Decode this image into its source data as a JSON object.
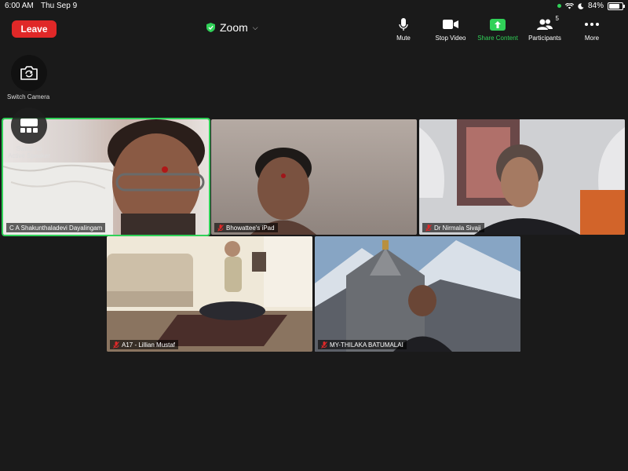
{
  "status_bar": {
    "time": "6:00 AM",
    "date": "Thu Sep 9",
    "battery": "84%",
    "battery_level": 0.84
  },
  "topbar": {
    "leave_label": "Leave",
    "app_title": "Zoom",
    "toolbar": [
      {
        "id": "mute",
        "label": "Mute",
        "icon": "microphone-icon"
      },
      {
        "id": "stop-video",
        "label": "Stop Video",
        "icon": "video-camera-icon"
      },
      {
        "id": "share",
        "label": "Share Content",
        "icon": "share-arrow-icon"
      },
      {
        "id": "participants",
        "label": "Participants",
        "icon": "participants-icon",
        "count": "5"
      },
      {
        "id": "more",
        "label": "More",
        "icon": "more-dots-icon"
      }
    ]
  },
  "controls": {
    "switch_camera_label": "Switch Camera",
    "switch_speaker_label": "Switch to Active Speaker"
  },
  "participants": [
    {
      "name": "C A Shakunthaladevi Dayalingam",
      "muted": false,
      "active": true
    },
    {
      "name": "Bhowattee's iPad",
      "muted": true,
      "active": false
    },
    {
      "name": "Dr Nirmala Sivaji",
      "muted": true,
      "active": false
    },
    {
      "name": "A17 - Lillian Mustaf",
      "muted": true,
      "active": false
    },
    {
      "name": "MY-THILAKA BATUMALAI",
      "muted": true,
      "active": false
    }
  ],
  "colors": {
    "leave": "#e02828",
    "accent_green": "#30d158",
    "background": "#1a1a1a"
  }
}
